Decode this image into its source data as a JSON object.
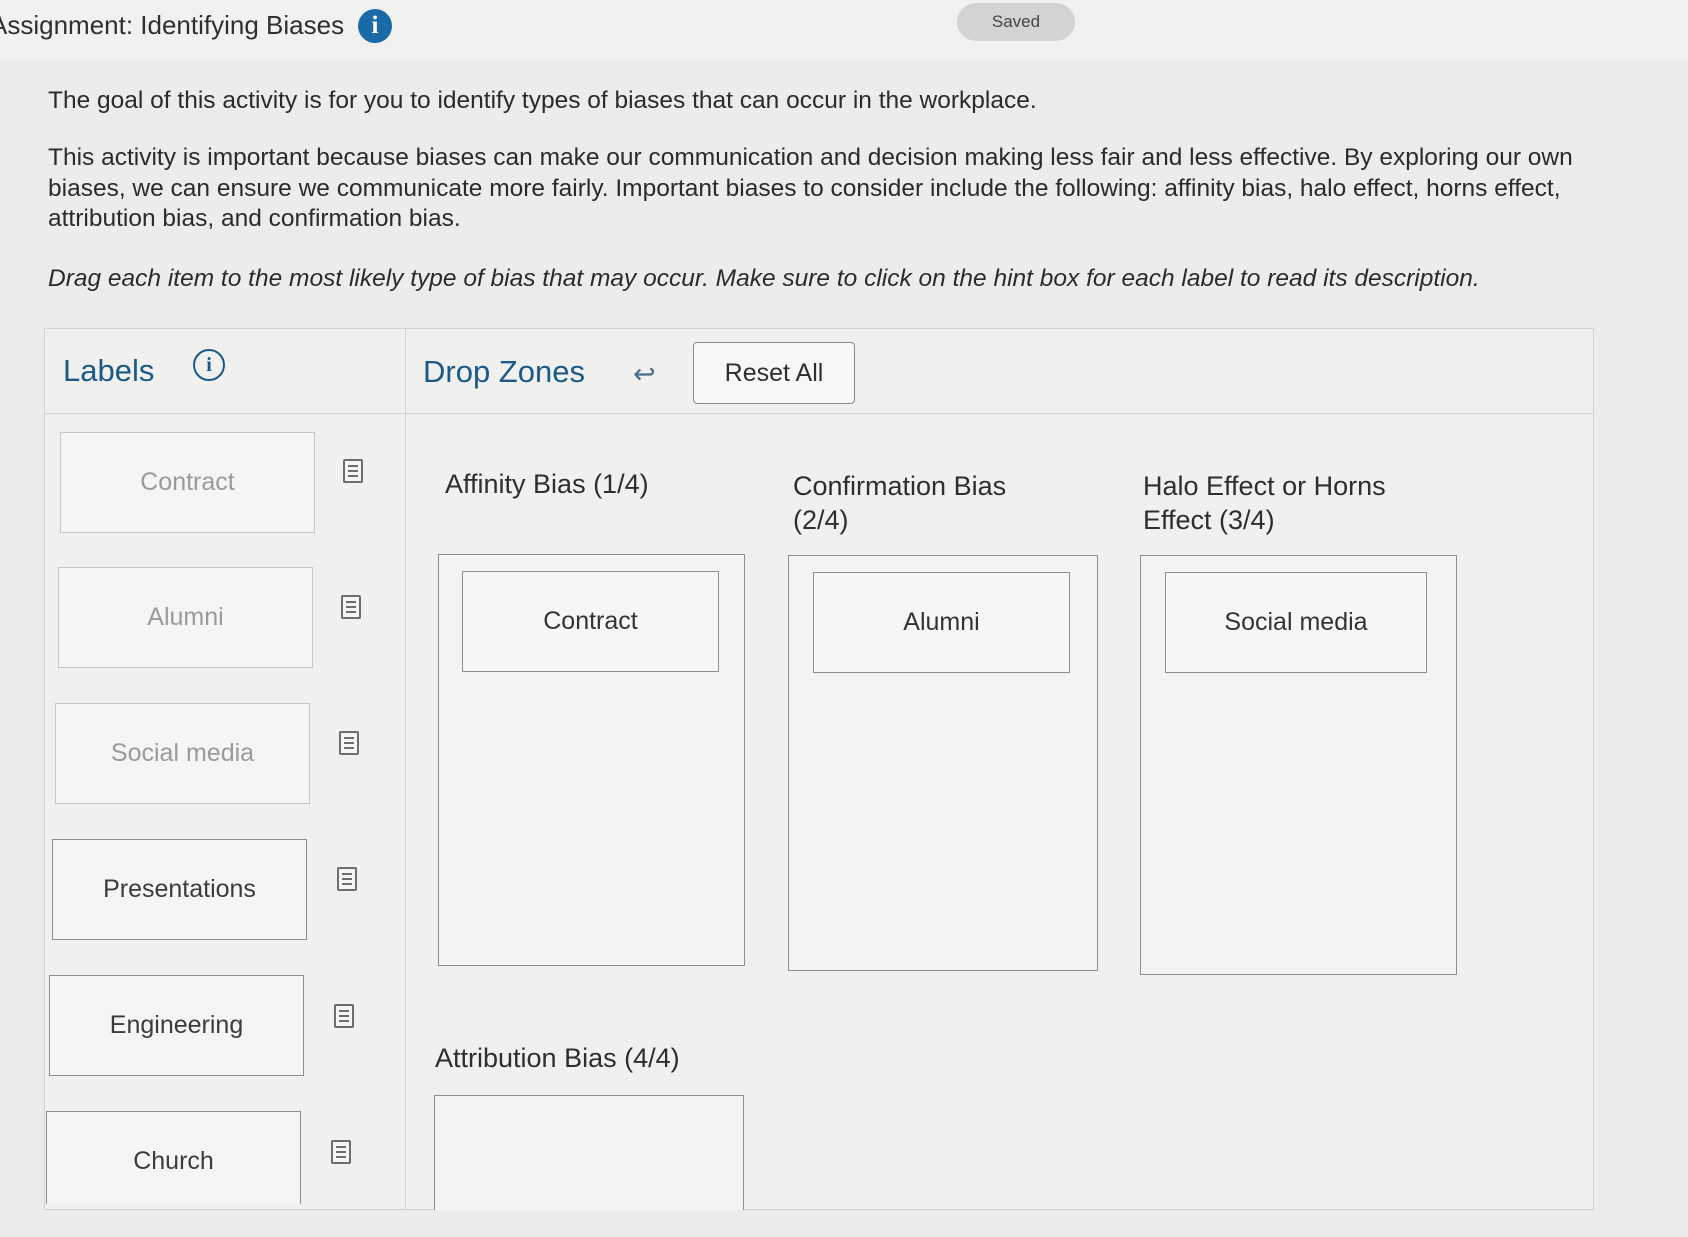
{
  "header": {
    "title": "Assignment: Identifying Biases",
    "saved_label": "Saved"
  },
  "intro": {
    "goal": "The goal of this activity is for you to identify types of biases that can occur in the workplace.",
    "importance": "This activity is important because biases can make our communication and decision making less fair and less effective. By exploring our own biases, we can ensure we communicate more fairly. Important biases to consider include the following: affinity bias, halo effect, horns effect, attribution bias, and confirmation bias.",
    "instruction": "Drag each item to the most likely type of bias that may occur. Make sure to click on the hint box for each label to read its description."
  },
  "labels_panel": {
    "title": "Labels",
    "items": [
      {
        "label": "Contract",
        "placed": true
      },
      {
        "label": "Alumni",
        "placed": true
      },
      {
        "label": "Social media",
        "placed": true
      },
      {
        "label": "Presentations",
        "placed": false
      },
      {
        "label": "Engineering",
        "placed": false
      },
      {
        "label": "Church",
        "placed": false
      }
    ]
  },
  "drop_panel": {
    "title": "Drop Zones",
    "reset_label": "Reset All",
    "zones": [
      {
        "title": "Affinity Bias (1/4)",
        "items": [
          "Contract"
        ]
      },
      {
        "title": "Confirmation Bias (2/4)",
        "items": [
          "Alumni"
        ]
      },
      {
        "title": "Halo Effect or Horns Effect (3/4)",
        "items": [
          "Social media"
        ]
      },
      {
        "title": "Attribution Bias (4/4)",
        "items": []
      }
    ]
  },
  "icons": {
    "info": "info-icon",
    "undo": "undo-arrow-icon",
    "hint": "hint-document-icon"
  },
  "colors": {
    "heading_blue": "#1b5a86",
    "info_blue": "#1a6aa8",
    "background": "#ececea"
  }
}
